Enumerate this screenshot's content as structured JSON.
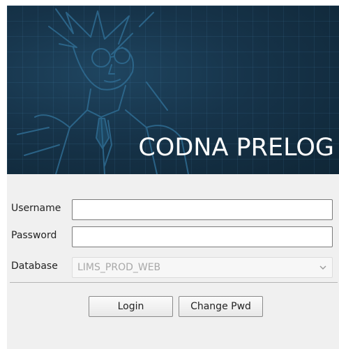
{
  "banner": {
    "title": "CODNA PRELOG"
  },
  "form": {
    "username_label": "Username",
    "username_value": "",
    "password_label": "Password",
    "password_value": "",
    "database_label": "Database",
    "database_value": "LIMS_PROD_WEB"
  },
  "buttons": {
    "login_label": "Login",
    "change_pwd_label": "Change Pwd"
  },
  "colors": {
    "banner_bg": "#163349",
    "banner_text": "#ffffff",
    "form_bg": "#f0f0f0",
    "disabled_text": "#a8a8a8"
  },
  "icons": {
    "dropdown": "chevron-down-icon",
    "banner_art": "character-illustration"
  }
}
